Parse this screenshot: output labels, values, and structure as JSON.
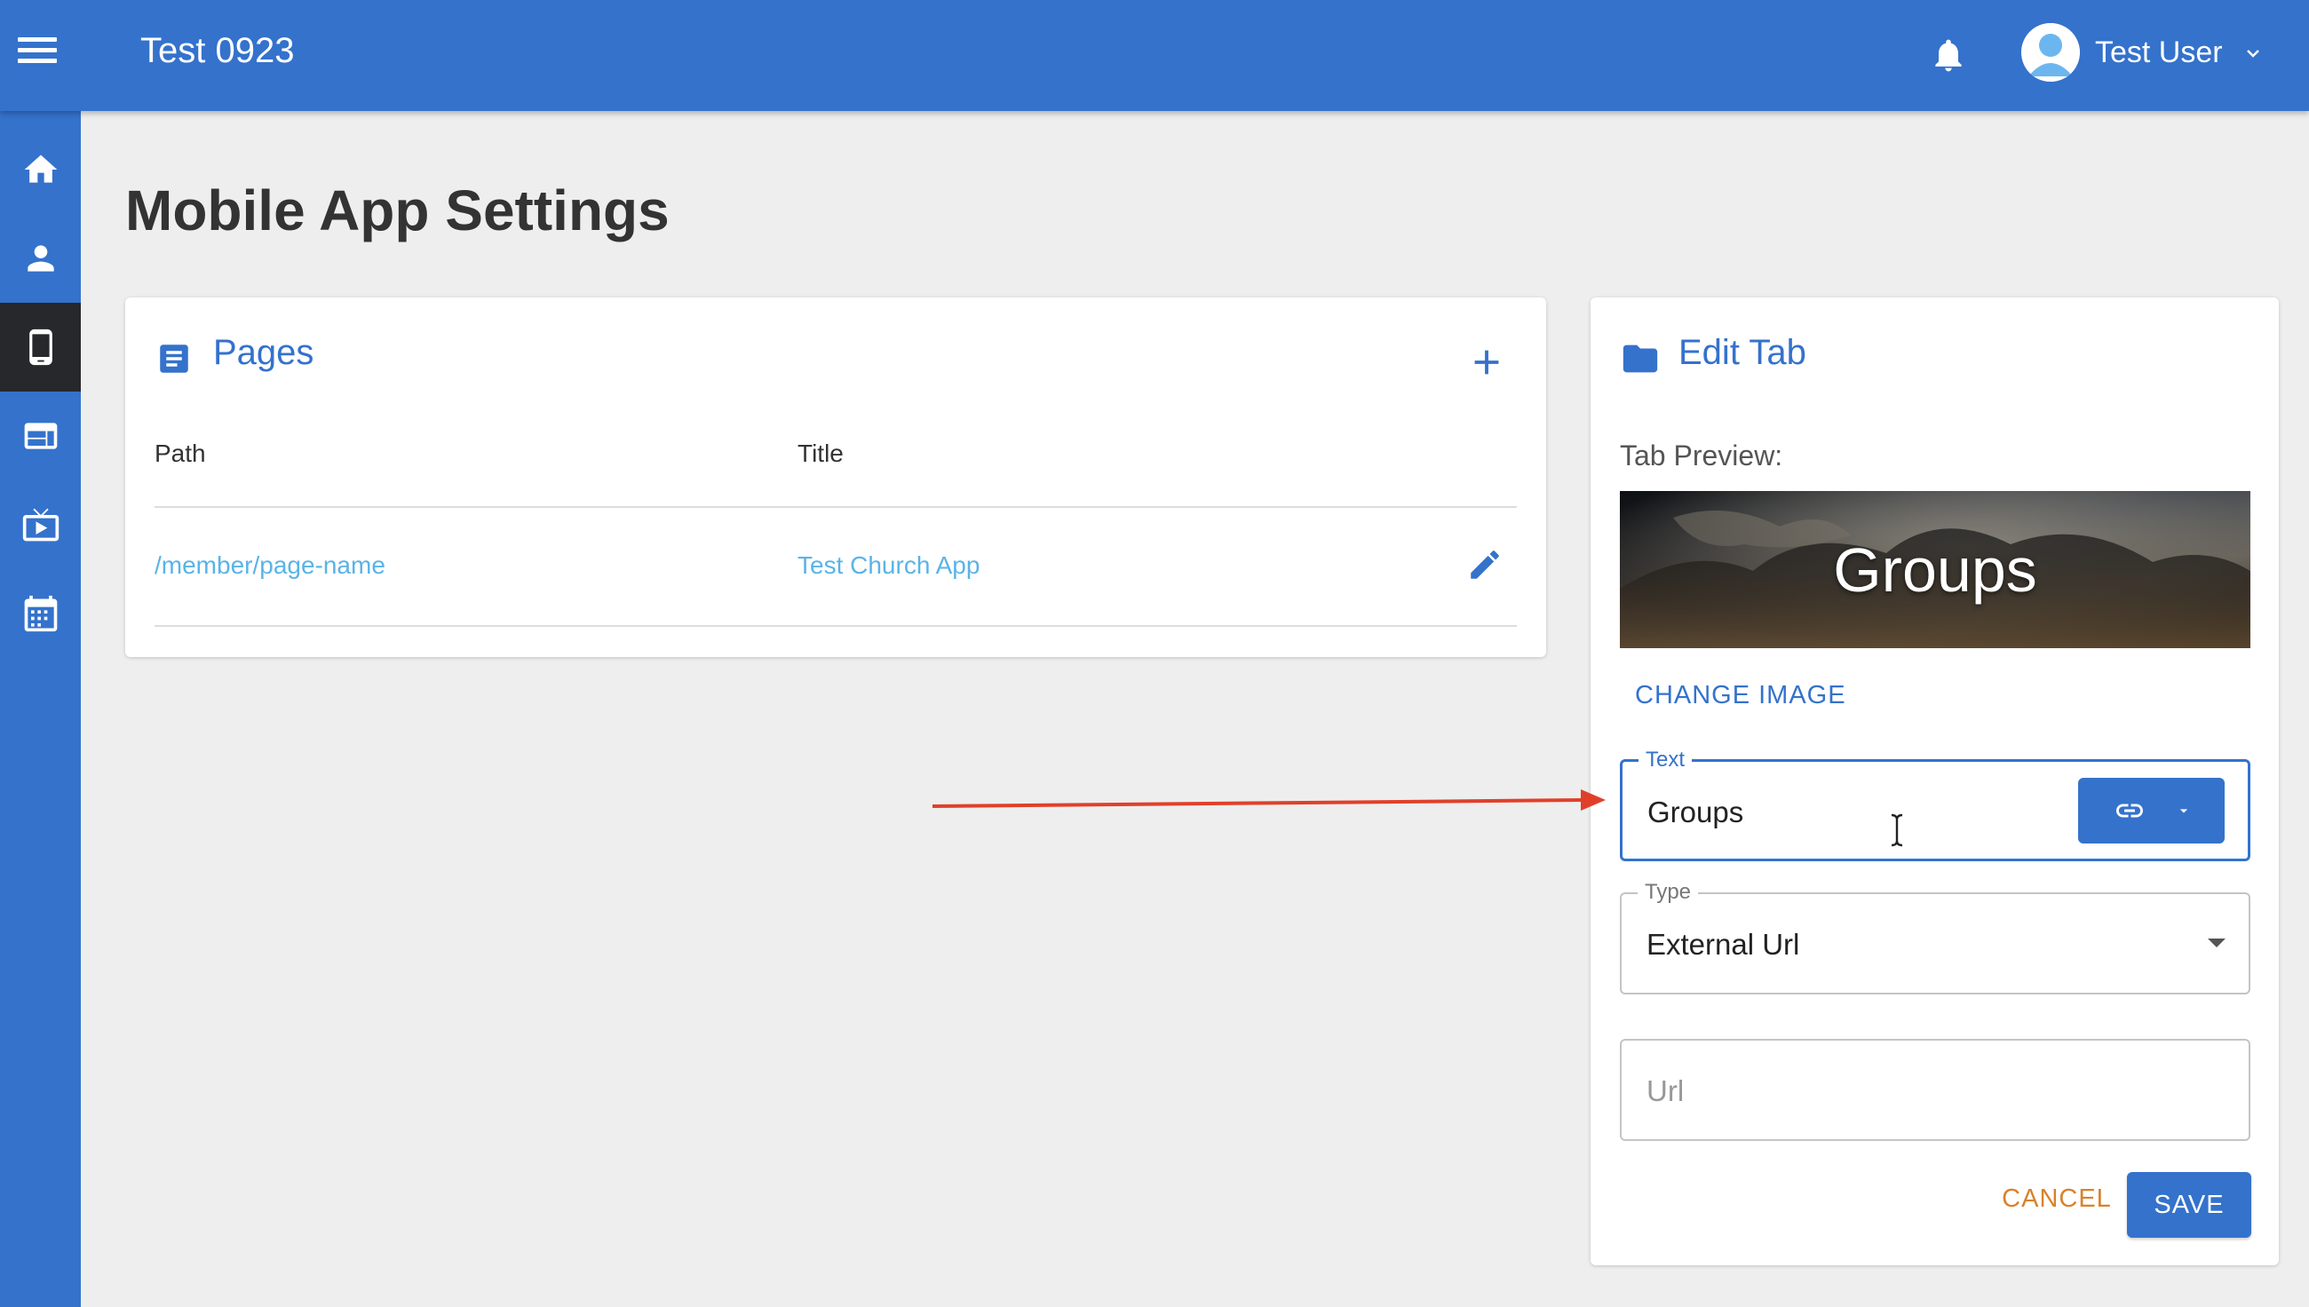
{
  "header": {
    "app_title": "Test 0923",
    "user_name": "Test User"
  },
  "sidebar": {
    "items": [
      {
        "name": "home",
        "icon": "home-icon"
      },
      {
        "name": "people",
        "icon": "person-icon"
      },
      {
        "name": "mobile",
        "icon": "mobile-phone-icon",
        "active": true
      },
      {
        "name": "website",
        "icon": "web-layout-icon"
      },
      {
        "name": "streaming",
        "icon": "live-tv-icon"
      },
      {
        "name": "calendar",
        "icon": "calendar-icon"
      }
    ]
  },
  "page": {
    "title": "Mobile App Settings"
  },
  "pages_card": {
    "title": "Pages",
    "columns": [
      "Path",
      "Title"
    ],
    "rows": [
      {
        "path": "/member/page-name",
        "title": "Test Church App"
      }
    ]
  },
  "edit_tab": {
    "title": "Edit Tab",
    "preview_label": "Tab Preview:",
    "preview_text": "Groups",
    "change_image_label": "CHANGE IMAGE",
    "text_field": {
      "label": "Text",
      "value": "Groups"
    },
    "type_field": {
      "label": "Type",
      "value": "External Url"
    },
    "url_field": {
      "placeholder": "Url",
      "value": ""
    },
    "cancel_label": "CANCEL",
    "save_label": "SAVE"
  },
  "colors": {
    "primary": "#3472cc",
    "link": "#5ab4e6",
    "cancel": "#d9822b",
    "annotation_arrow": "#e0402a",
    "active_sidebar": "#26282c"
  }
}
